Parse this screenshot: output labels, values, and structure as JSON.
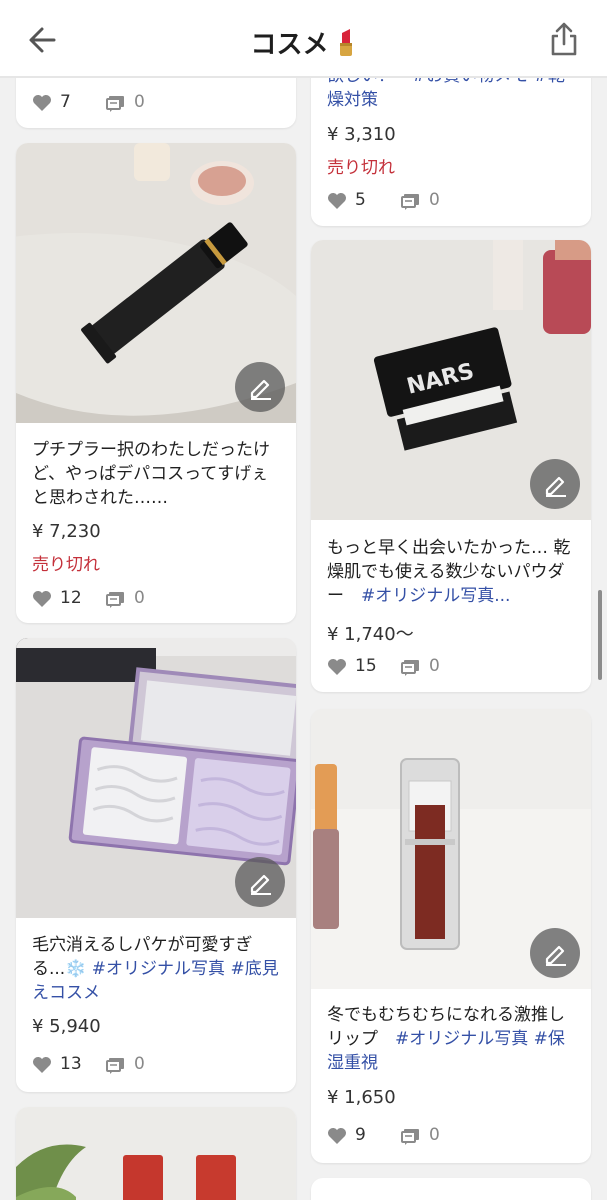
{
  "header": {
    "title": "コスメ",
    "title_emoji": "lipstick-emoji",
    "back_icon": "back-arrow-icon",
    "share_icon": "share-icon"
  },
  "cards": {
    "c0": {
      "likes": "7",
      "comments": "0"
    },
    "c1": {
      "desc": "プチプラー択のわたしだったけど、やっぱデパコスってすげぇと思わされた……",
      "price": "¥ 7,230",
      "soldout": "売り切れ",
      "likes": "12",
      "comments": "0"
    },
    "c2": {
      "desc_prefix": "毛穴消えるしパケが可愛すぎる...❄️ ",
      "tag1": "#オリジナル写真",
      "tag2": " #底見えコスメ",
      "price": "¥ 5,940",
      "likes": "13",
      "comments": "0"
    },
    "r0": {
      "desc_tail": "欲しい？　#お買い物メモ #乾燥対策",
      "price": "¥ 3,310",
      "soldout": "売り切れ",
      "likes": "5",
      "comments": "0"
    },
    "r1": {
      "desc_prefix": "もっと早く出会いたかった… 乾燥肌でも使える数少ないパウダー　",
      "tag1": "#オリジナル写真...",
      "price": "¥ 1,740〜",
      "likes": "15",
      "comments": "0"
    },
    "r2": {
      "desc_prefix": "冬でもむちむちになれる激推しリップ　",
      "tag1": "#オリジナル写真",
      "tag2": " #保湿重視",
      "price": "¥ 1,650",
      "likes": "9",
      "comments": "0"
    }
  },
  "colors": {
    "accent_tag": "#3450a6",
    "soldout": "#c4303a",
    "background": "#f1f1f1"
  }
}
